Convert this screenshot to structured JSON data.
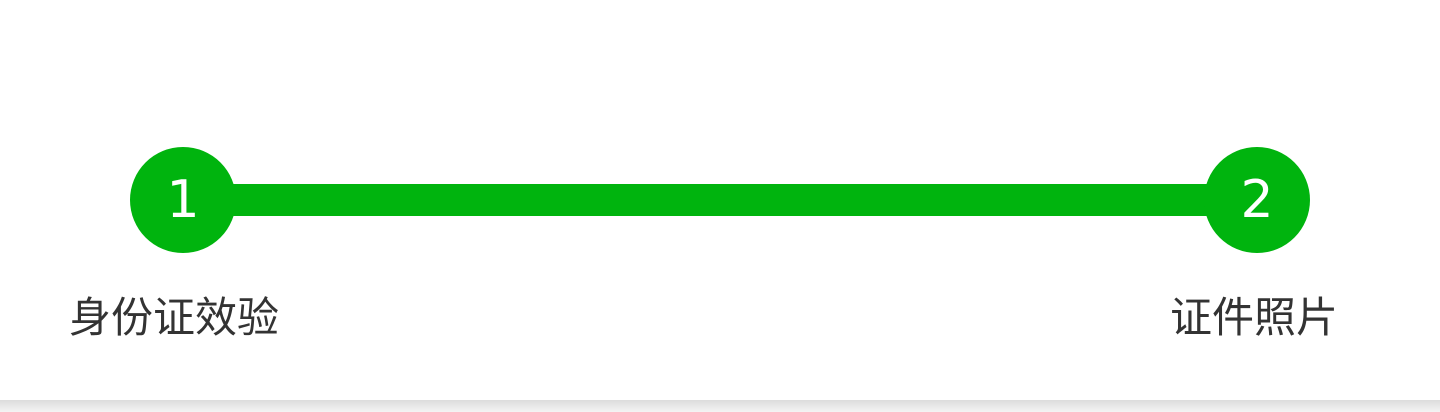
{
  "steps": [
    {
      "number": "1",
      "label": "身份证效验",
      "state": "active"
    },
    {
      "number": "2",
      "label": "证件照片",
      "state": "active"
    }
  ],
  "colors": {
    "accent": "#00b40e",
    "label_text": "#333333",
    "background": "#ffffff"
  }
}
